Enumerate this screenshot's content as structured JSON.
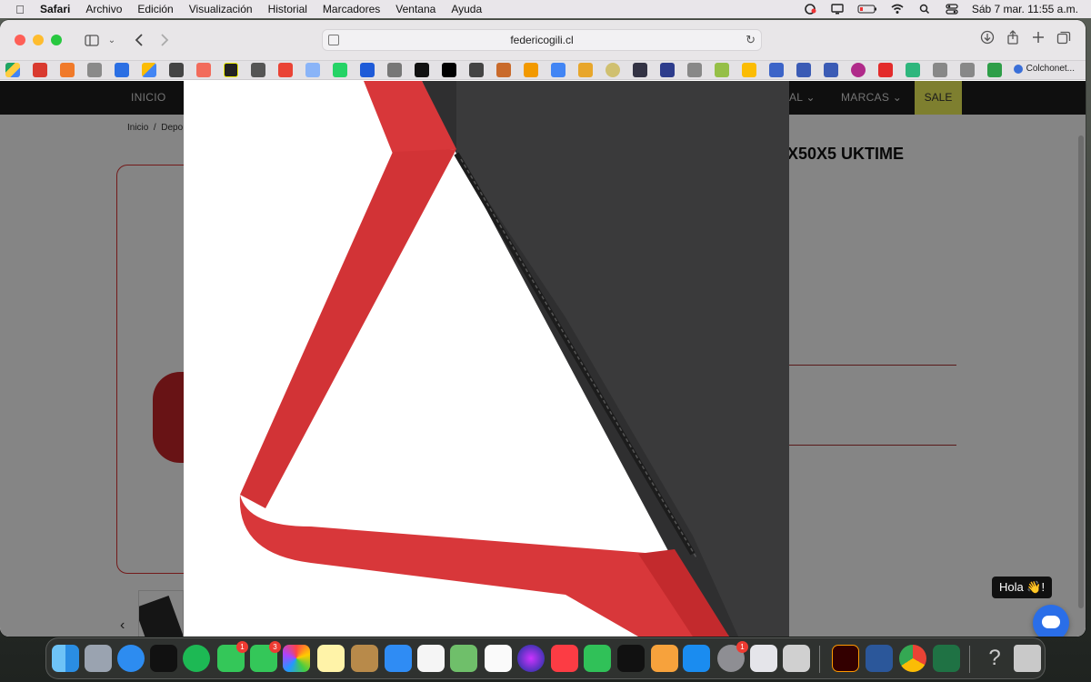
{
  "menubar": {
    "app_name": "Safari",
    "items": [
      "Archivo",
      "Edición",
      "Visualización",
      "Historial",
      "Marcadores",
      "Ventana",
      "Ayuda"
    ],
    "clock": "Sáb 7 mar.  11:55 a.m."
  },
  "browser": {
    "url": "federicogili.cl",
    "bookmark_last_label": "Colchonet..."
  },
  "page": {
    "nav": {
      "inicio": "INICIO",
      "al": "AL",
      "marcas": "MARCAS",
      "sale": "SALE"
    },
    "breadcrumb": {
      "home": "Inicio",
      "sep": "/",
      "partial": "Depo"
    },
    "product_title_partial": "X50X5 UKTIME",
    "thumb_prev_label": "‹",
    "chat_greeting": "Hola 👋!"
  },
  "colors": {
    "nav_bg": "#1e1e1e",
    "sale_bg": "#f2f45b",
    "strap_red": "#d8373a",
    "bag_black": "#2f2f30",
    "chat_blue": "#2a6ee8",
    "accent_border": "#d33333"
  },
  "dock": {
    "badges": [
      "1",
      "3",
      "1"
    ]
  }
}
